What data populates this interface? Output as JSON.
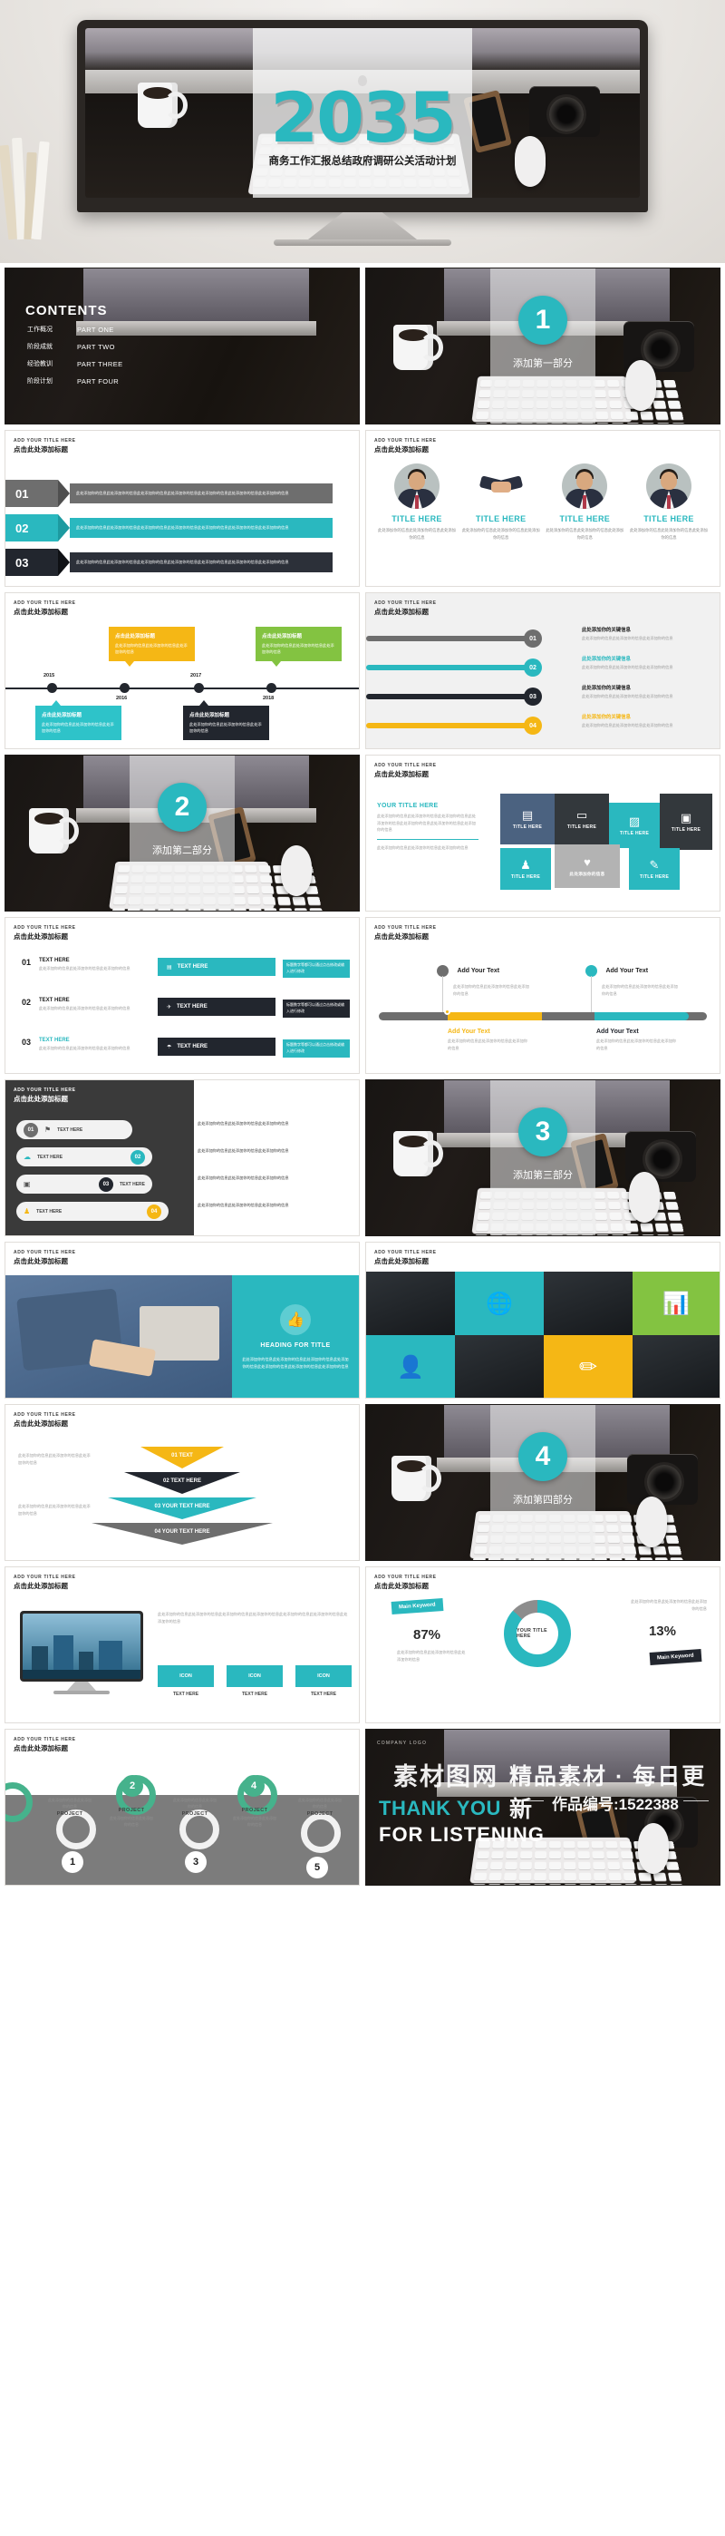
{
  "cover": {
    "year": "2035",
    "subtitle": "商务工作汇报总结政府调研公关活动计划"
  },
  "common": {
    "title_en": "ADD YOUR TITLE HERE",
    "title_cn": "点击此处添加标题",
    "body_short": "此处添加你的信息此处添加你的信息此处添加你的信息",
    "body_long": "此处添加你的信息此处添加你的信息此处添加你的信息此处添加你的信息此处添加你的信息此处添加你的信息此处添加你的信息",
    "key_info": "此处添加你的关键信息",
    "title_here": "TITLE HERE",
    "your_title_here": "YOUR TITLE HERE",
    "text_here": "TEXT HERE",
    "add_your_text": "Add Your Text",
    "project": "PROJECT",
    "icon": "ICON",
    "main_keyword": "Main Keyword",
    "ribbon_note": "标题数字等都可以通过点击修改或输入进行修改"
  },
  "contents": {
    "title": "CONTENTS",
    "items": [
      {
        "cn": "工作概况",
        "en": "PART ONE"
      },
      {
        "cn": "阶段成就",
        "en": "PART TWO"
      },
      {
        "cn": "经验教训",
        "en": "PART THREE"
      },
      {
        "cn": "阶段计划",
        "en": "PART FOUR"
      }
    ]
  },
  "sections": [
    {
      "num": "1",
      "cn": "添加第一部分"
    },
    {
      "num": "2",
      "cn": "添加第二部分"
    },
    {
      "num": "3",
      "cn": "添加第三部分"
    },
    {
      "num": "4",
      "cn": "添加第四部分"
    }
  ],
  "arrow_bars": [
    {
      "num": "01",
      "color": "#6e6e6e"
    },
    {
      "num": "02",
      "color": "#2ab8bf"
    },
    {
      "num": "03",
      "color": "#22262e"
    }
  ],
  "timeline": {
    "years": [
      "2015",
      "2016",
      "2017",
      "2018"
    ],
    "cards": [
      {
        "year": "2015",
        "color": "#2ec3c9",
        "title": "点击此处添加标题",
        "pos": "below"
      },
      {
        "year": "2016",
        "color": "#f5b715",
        "title": "点击此处添加标题",
        "pos": "above"
      },
      {
        "year": "2017",
        "color": "#22262e",
        "title": "点击此处添加标题",
        "pos": "below"
      },
      {
        "year": "2018",
        "color": "#83c341",
        "title": "点击此处添加标题",
        "pos": "above"
      }
    ]
  },
  "pills": [
    {
      "num": "01",
      "color": "#6e6e6e",
      "title_color": "#222"
    },
    {
      "num": "02",
      "color": "#2ab8bf",
      "title_color": "#2ab8bf"
    },
    {
      "num": "03",
      "color": "#22262e",
      "title_color": "#222"
    },
    {
      "num": "04",
      "color": "#f5b715",
      "title_color": "#f5b715"
    }
  ],
  "tiles": [
    {
      "label": "TITLE HERE",
      "icon": "▤",
      "bg": "#4b6280"
    },
    {
      "label": "TITLE HERE",
      "icon": "▭",
      "bg": "#33383c"
    },
    {
      "label": "TITLE HERE",
      "icon": "▨",
      "bg": "#2ab8bf"
    },
    {
      "label": "TITLE HERE",
      "icon": "▣",
      "bg": "#33383c"
    },
    {
      "label": "TITLE HERE",
      "icon": "♟",
      "bg": "#2ab8bf"
    },
    {
      "label": "此处添加你的信息",
      "icon": "♥",
      "bg": "#b3b3b3"
    },
    {
      "label": "TITLE HERE",
      "icon": "✎",
      "bg": "#2ab8bf"
    }
  ],
  "text_rows": [
    {
      "num": "01",
      "label": "TEXT HERE",
      "ribbon_bg": "#2ab8bf",
      "icon": "▤"
    },
    {
      "num": "02",
      "label": "TEXT HERE",
      "ribbon_bg": "#22262e",
      "icon": "✈"
    },
    {
      "num": "03",
      "label": "TEXT HERE",
      "ribbon_bg": "#22262e",
      "icon": "☂"
    }
  ],
  "add_text_items": [
    {
      "label": "Add Your Text",
      "color": "#6e6e6e"
    },
    {
      "label": "Add Your Text",
      "color": "#2ab8bf"
    },
    {
      "label": "Add Your Text",
      "color": "#f5b715"
    },
    {
      "label": "Add Your Text",
      "color": "#22262e"
    }
  ],
  "lozenges": [
    {
      "num": "01",
      "label": "TEXT HERE",
      "color": "#6e6e6e"
    },
    {
      "num": "02",
      "label": "TEXT HERE",
      "color": "#2ab8bf"
    },
    {
      "num": "03",
      "label": "TEXT HERE",
      "color": "#22262e"
    },
    {
      "num": "04",
      "label": "TEXT HERE",
      "color": "#f5b715"
    }
  ],
  "photo_slide": {
    "heading": "HEADING FOR TITLE",
    "icon": "👍"
  },
  "icon_grid": [
    {
      "icon": "🌐",
      "bg": "#2ab8bf"
    },
    {
      "icon": "📊",
      "bg": "#83c341"
    },
    {
      "icon": "👤",
      "bg": "#2ab8bf"
    },
    {
      "icon": "✏",
      "bg": "#f5b715"
    }
  ],
  "chevrons": [
    {
      "label": "01 TEXT",
      "color": "#f5b715"
    },
    {
      "label": "02 TEXT HERE",
      "color": "#22262e"
    },
    {
      "label": "03 YOUR TEXT HERE",
      "color": "#2ab8bf"
    },
    {
      "label": "04 YOUR TEXT HERE",
      "color": "#6e6e6e"
    }
  ],
  "icon_row": [
    {
      "label": "ICON",
      "sub": "TEXT HERE"
    },
    {
      "label": "ICON",
      "sub": "TEXT HERE"
    },
    {
      "label": "ICON",
      "sub": "TEXT HERE"
    }
  ],
  "chart_data": {
    "type": "pie",
    "title": "YOUR TITLE HERE",
    "labels": [
      "Main Keyword",
      "Main Keyword"
    ],
    "values": [
      87,
      13
    ],
    "value_labels": [
      "87%",
      "13%"
    ],
    "colors": [
      "#2ab8bf",
      "#8d8d8d"
    ],
    "legend": "left-right"
  },
  "process": {
    "steps": [
      "1",
      "2",
      "3",
      "4",
      "5"
    ],
    "label": "PROJECT",
    "body": "此处添加你的信息此处添加你的信息"
  },
  "thank_you": {
    "company_logo": "COMPANY LOGO",
    "line1": "THANK YOU",
    "line2": "FOR LISTENING"
  },
  "watermark": {
    "logo": "素材图网",
    "tagline": "精品素材 · 每日更新",
    "code": "作品编号:1522388"
  }
}
